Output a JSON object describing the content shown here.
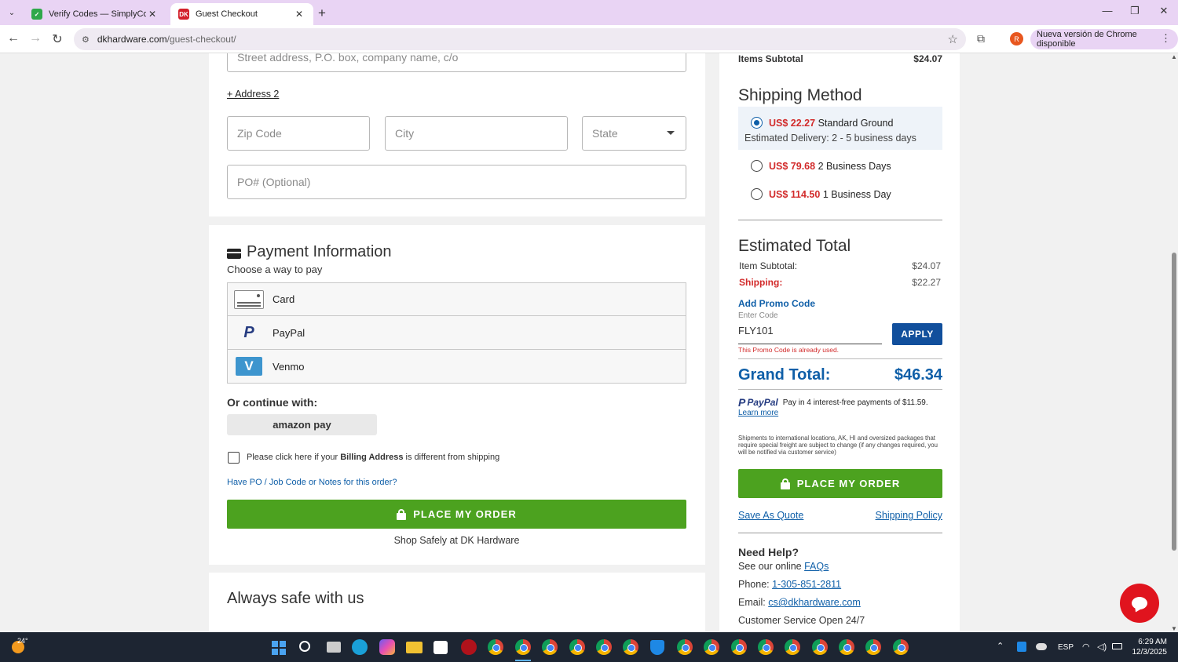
{
  "browser": {
    "tabs": [
      {
        "title": "Verify Codes — SimplyCodes",
        "favicon": "simplycodes-icon",
        "active": false
      },
      {
        "title": "Guest Checkout",
        "favicon": "dk-icon",
        "favicon_text": "DK",
        "active": true
      }
    ],
    "url_host": "dkhardware.com",
    "url_path": "/guest-checkout/",
    "profile_initial": "R",
    "update_text": "Nueva versión de Chrome disponible"
  },
  "address": {
    "street_placeholder": "Street address, P.O. box, company name, c/o",
    "address2_link": "+ Address 2",
    "zip_placeholder": "Zip Code",
    "city_placeholder": "City",
    "state_placeholder": "State",
    "po_placeholder": "PO# (Optional)"
  },
  "payment": {
    "title": "Payment Information",
    "subtitle": "Choose a way to pay",
    "options": [
      {
        "label": "Card",
        "icon": "card-icon"
      },
      {
        "label": "PayPal",
        "icon": "paypal-icon"
      },
      {
        "label": "Venmo",
        "icon": "venmo-icon"
      }
    ],
    "continue_with": "Or continue with:",
    "amazon_pay": "amazon pay",
    "billing_checkbox_pre": "Please click here if your ",
    "billing_checkbox_bold": "Billing Address",
    "billing_checkbox_post": " is different from shipping",
    "po_notes_link": "Have PO / Job Code or Notes for this order?",
    "place_order": "PLACE MY ORDER",
    "shop_safely": "Shop Safely at DK Hardware",
    "always_safe": "Always safe with us"
  },
  "summary": {
    "items_subtotal_label": "Items Subtotal",
    "items_subtotal_value": "$24.07",
    "shipping_method_title": "Shipping Method",
    "shipping_options": [
      {
        "price": "US$ 22.27",
        "name": "Standard Ground",
        "note": "Estimated Delivery: 2 - 5 business days",
        "selected": true
      },
      {
        "price": "US$ 79.68",
        "name": "2 Business Days",
        "selected": false
      },
      {
        "price": "US$ 114.50",
        "name": "1 Business Day",
        "selected": false
      }
    ],
    "estimated_total_title": "Estimated Total",
    "item_subtotal_label": "Item Subtotal:",
    "item_subtotal_value": "$24.07",
    "shipping_label": "Shipping:",
    "shipping_value": "$22.27",
    "promo_title": "Add Promo Code",
    "promo_field_label": "Enter Code",
    "promo_value": "FLY101",
    "apply_button": "APPLY",
    "promo_error": "This Promo Code is already used.",
    "grand_total_label": "Grand Total:",
    "grand_total_value": "$46.34",
    "paypal_brand": "PayPal",
    "paypal_text": "Pay in 4 interest-free payments of $11.59.",
    "learn_more": "Learn more",
    "shipping_notice": "Shipments to international locations, AK, HI and oversized packages that require special freight are subject to change (if any changes required, you will be notified via customer service)",
    "place_order": "PLACE MY ORDER",
    "save_as_quote": "Save As Quote",
    "shipping_policy": "Shipping Policy",
    "need_help": "Need Help?",
    "faqs_pre": "See our online ",
    "faqs_link": "FAQs",
    "phone_label": "Phone: ",
    "phone_value": "1-305-851-2811",
    "email_label": "Email: ",
    "email_value": "cs@dkhardware.com",
    "service_hours": "Customer Service Open 24/7"
  },
  "taskbar": {
    "weather": "24°",
    "lang": "ESP",
    "time": "6:29 AM",
    "date": "12/3/2025"
  },
  "colors": {
    "green": "#4ca21f",
    "blue": "#0f5fa8",
    "red": "#d22b2b",
    "navy_button": "#114f9c"
  }
}
